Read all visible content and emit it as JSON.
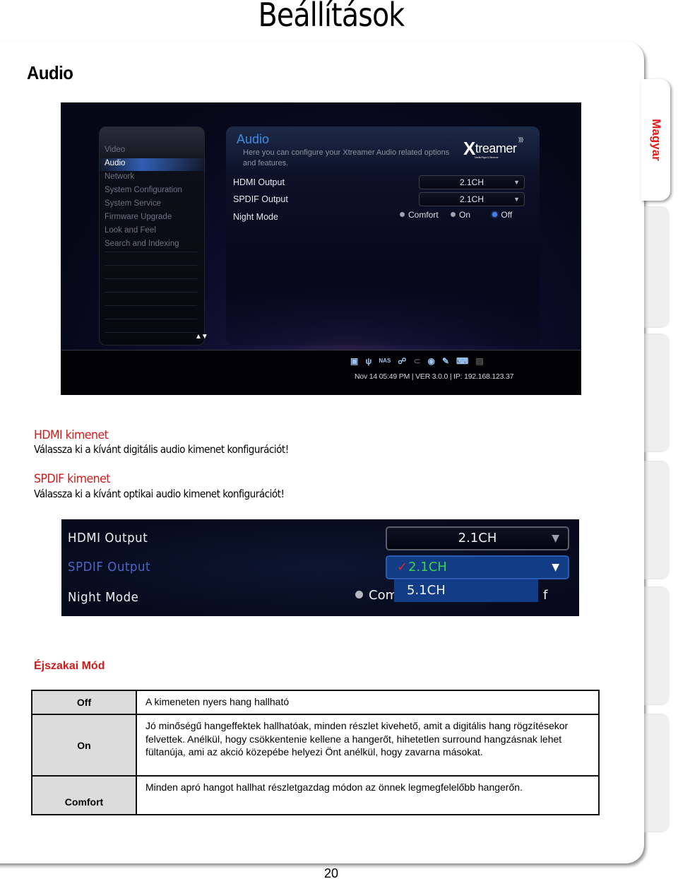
{
  "page": {
    "title": "Beállítások",
    "section_heading": "Audio",
    "page_number": "20",
    "side_tabs": [
      {
        "label": "Magyar",
        "active": true
      },
      {
        "label": "",
        "active": false
      },
      {
        "label": "",
        "active": false
      },
      {
        "label": "",
        "active": false
      },
      {
        "label": "",
        "active": false
      },
      {
        "label": "",
        "active": false
      },
      {
        "label": "",
        "active": false
      }
    ]
  },
  "screenshot1": {
    "menu_items": [
      {
        "label": "Video",
        "active": false
      },
      {
        "label": "Audio",
        "active": true
      },
      {
        "label": "Network",
        "active": false
      },
      {
        "label": "System Configuration",
        "active": false
      },
      {
        "label": "System Service",
        "active": false
      },
      {
        "label": "Firmware Upgrade",
        "active": false
      },
      {
        "label": "Look and Feel",
        "active": false
      },
      {
        "label": "Search and Indexing",
        "active": false
      }
    ],
    "menu_scroll_arrows": "▲▼",
    "panel_title": "Audio",
    "panel_description": "Here you can configure your Xtreamer Audio related options and features.",
    "logo": {
      "x": "X",
      "rest": "treamer",
      "tagline": "Media Player & Streamer"
    },
    "settings": {
      "hdmi_label": "HDMI Output",
      "hdmi_value": "2.1CH",
      "spdif_label": "SPDIF Output",
      "spdif_value": "2.1CH",
      "night_label": "Night Mode",
      "night_options": [
        {
          "label": "Comfort",
          "selected": false
        },
        {
          "label": "On",
          "selected": false
        },
        {
          "label": "Off",
          "selected": true
        }
      ]
    },
    "status_icons": [
      "hdd-icon",
      "usb-icon",
      "nas-icon",
      "network-icon",
      "link-icon",
      "globe-icon",
      "usb-stick-icon",
      "wireless-keyboard-icon",
      "sd-card-icon"
    ],
    "nas_label": "NAS",
    "status_text": "Nov 14 05:49 PM | VER 3.0.0 | IP: 192.168.123.37",
    "accent_color": "#3d8ce0"
  },
  "text": {
    "hdmi_heading": "HDMI kimenet",
    "hdmi_body": "Válassza ki a kívánt digitális audio kimenet konfigurációt!",
    "spdif_heading": "SPDIF kimenet",
    "spdif_body": "Válassza ki a kívánt optikai audio kimenet konfigurációt!"
  },
  "screenshot2": {
    "hdmi_label": "HDMI Output",
    "hdmi_value": "2.1CH",
    "spdif_label": "SPDIF Output",
    "spdif_current": "2.1CH",
    "spdif_options": [
      "2.1CH",
      "5.1CH"
    ],
    "dropdown_option": "5.1CH",
    "night_label": "Night Mode",
    "night_partial": "Com",
    "night_tail": "f"
  },
  "night_mode": {
    "title": "Éjszakai Mód",
    "rows": [
      {
        "mode": "Off",
        "description": "A kimeneten nyers hang hallható"
      },
      {
        "mode": "On",
        "description": "Jó minőségű hangeffektek hallhatóak, minden részlet kivehető, amit a digitális hang rögzítésekor felvettek. Anélkül, hogy csökkentenie kellene a hangerőt, hihetetlen surround hangzásnak lehet fültanúja, ami az akció közepébe helyezi Önt anélkül, hogy zavarna másokat."
      },
      {
        "mode": "Comfort",
        "description": "Minden apró hangot hallhat részletgazdag módon az önnek legmegfelelőbb hangerőn."
      }
    ]
  },
  "colors": {
    "heading_red": "#d21a1a",
    "tab_red": "#e11a1a",
    "table_key_bg": "#dcdcdc"
  }
}
